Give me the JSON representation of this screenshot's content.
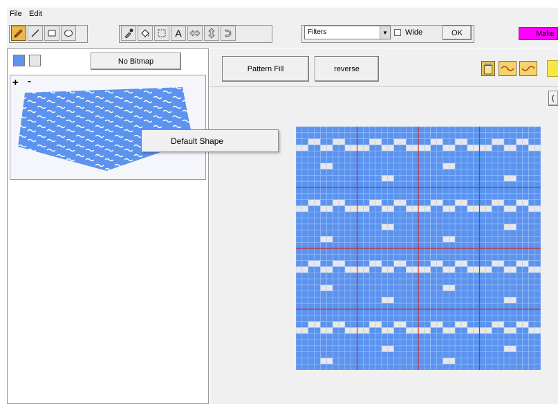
{
  "menu": {
    "file": "File",
    "edit": "Edit"
  },
  "toolbar": {
    "tools_left": [
      "pencil-icon",
      "line-icon",
      "rectangle-icon",
      "ellipse-icon"
    ],
    "tools_mid": [
      "eyedropper-icon",
      "paint-bucket-icon",
      "selection-icon",
      "text-icon",
      "flip-horizontal-icon",
      "flip-vertical-icon",
      "rotate-icon"
    ],
    "text_tool_label": "A",
    "filters_label": "Filters",
    "wide_label": "Wide",
    "ok_label": "OK",
    "make_label": "Make"
  },
  "left_panel": {
    "colors": [
      "#5b93ef",
      "#e6e6e6"
    ],
    "no_bitmap_label": "No Bitmap",
    "plus_label": "+",
    "minus_label": "-"
  },
  "context_menu": {
    "item": "Default Shape"
  },
  "right_panel": {
    "pattern_fill_label": "Pattern Fill",
    "reverse_label": "reverse",
    "partial_label": "(",
    "icons": [
      "clipboard-icon",
      "pattern-icon-1",
      "pattern-icon-2"
    ]
  },
  "colors": {
    "grid_blue": "#5b93ef",
    "grid_light": "#e8e8e8",
    "grid_line": "#a9c6f7",
    "guide_red": "#d22a2a",
    "make_magenta": "#ff00ff",
    "yellow": "#f5e842",
    "active_tool": "#e8b84a"
  },
  "grid": {
    "cols": 40,
    "rows": 40,
    "motif_size": 20,
    "motif_light_cells": [
      [
        2,
        2
      ],
      [
        2,
        3
      ],
      [
        2,
        6
      ],
      [
        2,
        7
      ],
      [
        3,
        0
      ],
      [
        3,
        1
      ],
      [
        3,
        4
      ],
      [
        3,
        5
      ],
      [
        3,
        8
      ],
      [
        3,
        9
      ],
      [
        6,
        4
      ],
      [
        6,
        5
      ],
      [
        8,
        14
      ],
      [
        8,
        15
      ],
      [
        12,
        2
      ],
      [
        12,
        3
      ],
      [
        12,
        6
      ],
      [
        12,
        7
      ],
      [
        13,
        0
      ],
      [
        13,
        1
      ],
      [
        13,
        4
      ],
      [
        13,
        5
      ],
      [
        13,
        8
      ],
      [
        13,
        9
      ],
      [
        16,
        14
      ],
      [
        16,
        15
      ],
      [
        18,
        4
      ],
      [
        18,
        5
      ],
      [
        2,
        12
      ],
      [
        2,
        13
      ],
      [
        2,
        16
      ],
      [
        2,
        17
      ],
      [
        3,
        10
      ],
      [
        3,
        11
      ],
      [
        3,
        14
      ],
      [
        3,
        15
      ],
      [
        3,
        18
      ],
      [
        3,
        19
      ],
      [
        12,
        12
      ],
      [
        12,
        13
      ],
      [
        12,
        16
      ],
      [
        12,
        17
      ],
      [
        13,
        10
      ],
      [
        13,
        11
      ],
      [
        13,
        14
      ],
      [
        13,
        15
      ],
      [
        13,
        18
      ],
      [
        13,
        19
      ]
    ]
  }
}
